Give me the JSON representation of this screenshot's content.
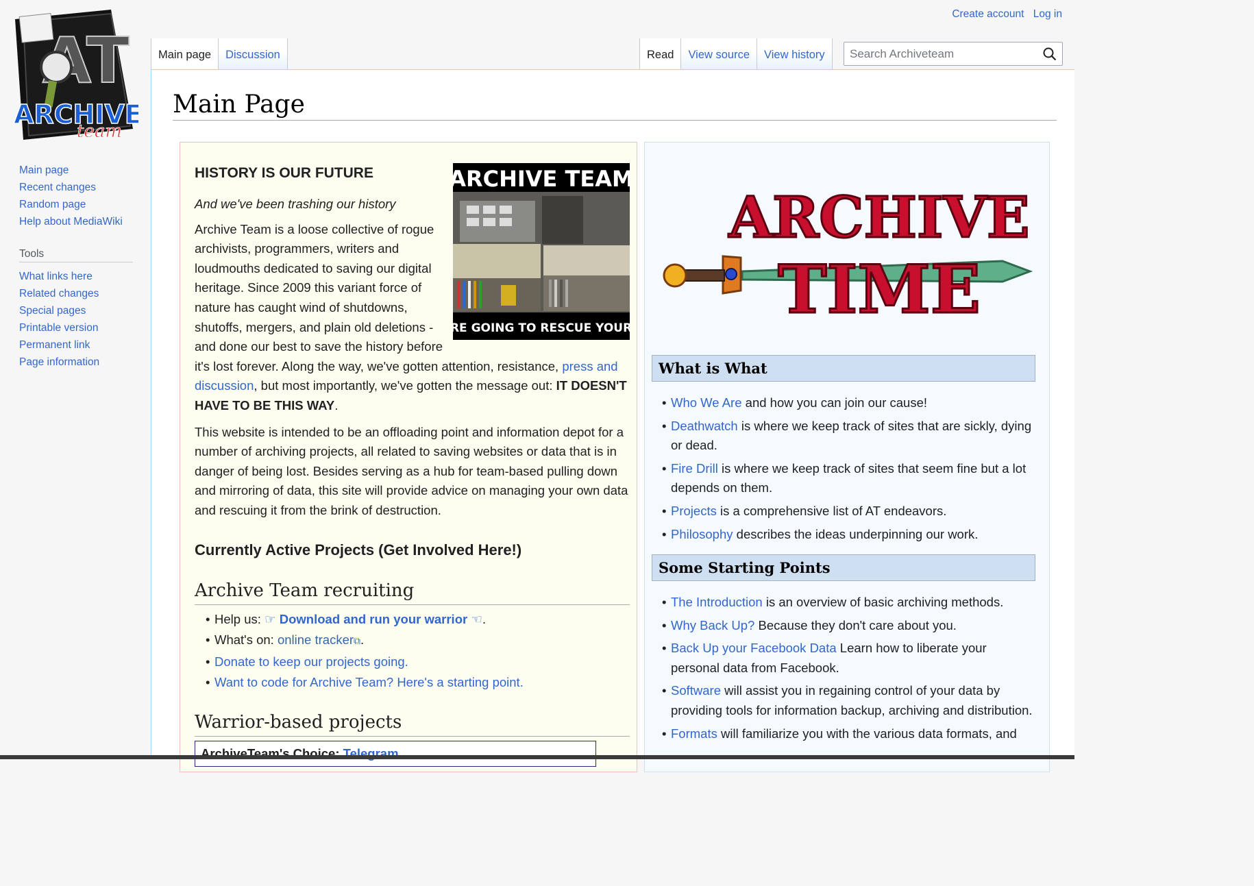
{
  "site": {
    "logo_text": "ARCHIVE",
    "logo_subtext": "team"
  },
  "personal_tools": {
    "create_account": "Create account",
    "log_in": "Log in"
  },
  "tabs_left": [
    {
      "label": "Main page"
    },
    {
      "label": "Discussion"
    }
  ],
  "tabs_right": [
    {
      "label": "Read"
    },
    {
      "label": "View source"
    },
    {
      "label": "View history"
    }
  ],
  "search": {
    "placeholder": "Search Archiveteam"
  },
  "sidebar": {
    "nav": [
      "Main page",
      "Recent changes",
      "Random page",
      "Help about MediaWiki"
    ],
    "tools_heading": "Tools",
    "tools": [
      "What links here",
      "Related changes",
      "Special pages",
      "Printable version",
      "Permanent link",
      "Page information"
    ]
  },
  "page": {
    "title": "Main Page",
    "history_heading": "HISTORY IS OUR FUTURE",
    "tagline": "And we've been trashing our history",
    "image": {
      "top_text": "ARCHIVE TEAM",
      "bottom_text": "WE ARE GOING TO RESCUE YOUR SHIT"
    },
    "intro_a": "Archive Team is a loose collective of rogue archivists, programmers, writers and loudmouths dedicated to saving our digital heritage. Since 2009 this variant force of nature has caught wind of shutdowns, shutoffs, mergers, and plain old deletions - and done our best to save the history before it's lost forever. Along the way, we've gotten attention, resistance, ",
    "intro_link": "press and discussion",
    "intro_b": ", but most importantly, we've gotten the message out: ",
    "intro_bold": "IT DOESN'T HAVE TO BE THIS WAY",
    "intro_end": ".",
    "para2": "This website is intended to be an offloading point and information depot for a number of archiving projects, all related to saving websites or data that is in danger of being lost. Besides serving as a hub for team-based pulling down and mirroring of data, this site will provide advice on managing your own data and rescuing it from the brink of destruction.",
    "active_heading": "Currently Active Projects (Get Involved Here!)",
    "recruiting": {
      "heading": "Archive Team recruiting",
      "help_prefix": "Help us: ",
      "help_link": "Download and run your warrior",
      "help_suffix": ".",
      "whats_on_prefix": "What's on: ",
      "whats_on_link": "online tracker",
      "whats_on_suffix": ".",
      "donate": "Donate to keep our projects going.",
      "code": "Want to code for Archive Team? Here's a starting point."
    },
    "warrior": {
      "heading": "Warrior-based projects",
      "choice_label": "ArchiveTeam's Choice: ",
      "choice_link": "Telegram"
    }
  },
  "right": {
    "logo_line1": "ARCHIVE",
    "logo_line2": "TIME",
    "what_heading": "What is What",
    "what_items": [
      {
        "link": "Who We Are",
        "text": " and how you can join our cause!"
      },
      {
        "link": "Deathwatch",
        "text": " is where we keep track of sites that are sickly, dying or dead."
      },
      {
        "link": "Fire Drill",
        "text": " is where we keep track of sites that seem fine but a lot depends on them."
      },
      {
        "link": "Projects",
        "text": " is a comprehensive list of AT endeavors."
      },
      {
        "link": "Philosophy",
        "text": " describes the ideas underpinning our work."
      }
    ],
    "start_heading": "Some Starting Points",
    "start_items": [
      {
        "link": "The Introduction",
        "text": " is an overview of basic archiving methods."
      },
      {
        "link": "Why Back Up?",
        "text": " Because they don't care about you."
      },
      {
        "link": "Back Up your Facebook Data",
        "text": " Learn how to liberate your personal data from Facebook."
      },
      {
        "link": "Software",
        "text": " will assist you in regaining control of your data by providing tools for information backup, archiving and distribution."
      },
      {
        "link": "Formats",
        "text": " will familiarize you with the various data formats, and"
      }
    ]
  },
  "colors": {
    "link": "#3366cc",
    "box_left_bg": "#fefef0",
    "box_right_bg": "#f5faff",
    "section_head_bg": "#cedff2",
    "logo_red": "#c8102e",
    "logo_blue": "#1c5fd4"
  }
}
